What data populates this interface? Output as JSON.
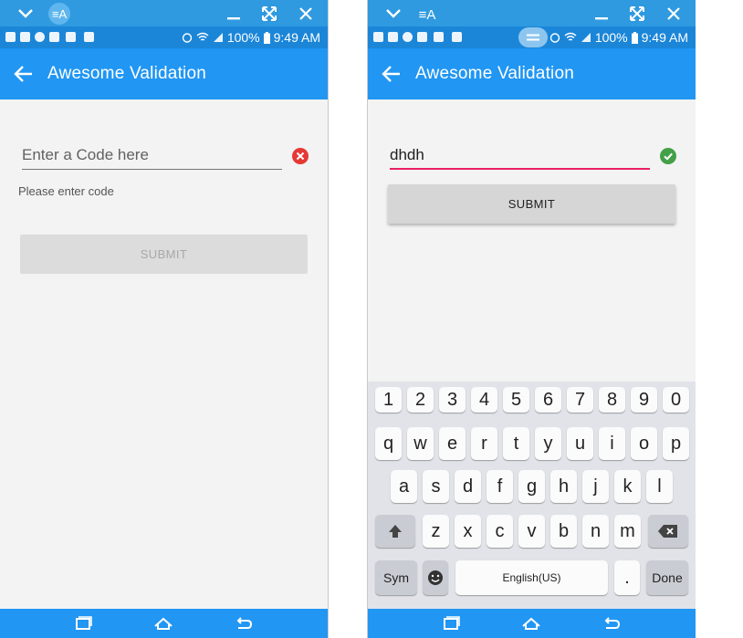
{
  "mirror_bar": {
    "icons": [
      "chevron-down-icon",
      "screen-mirror-app-icon",
      "minimize-icon",
      "fullscreen-icon",
      "close-icon"
    ]
  },
  "status_bar": {
    "battery": "100%",
    "time": "9:49 AM"
  },
  "app": {
    "title": "Awesome Validation"
  },
  "left_screen": {
    "code_input": {
      "value": "",
      "placeholder": "Enter a Code here"
    },
    "error_message": "Please enter code",
    "submit_label": "SUBMIT",
    "validation_icon": "error-icon",
    "colors": {
      "error": "#e53935"
    }
  },
  "right_screen": {
    "code_input": {
      "value": "dhdh",
      "placeholder": "Enter a Code here"
    },
    "submit_label": "SUBMIT",
    "validation_icon": "check-icon",
    "colors": {
      "success": "#43a047",
      "focus_line": "#e91e63"
    }
  },
  "keyboard": {
    "rows": [
      [
        "1",
        "2",
        "3",
        "4",
        "5",
        "6",
        "7",
        "8",
        "9",
        "0"
      ],
      [
        "q",
        "w",
        "e",
        "r",
        "t",
        "y",
        "u",
        "i",
        "o",
        "p"
      ],
      [
        "a",
        "s",
        "d",
        "f",
        "g",
        "h",
        "j",
        "k",
        "l"
      ],
      [
        "z",
        "x",
        "c",
        "v",
        "b",
        "n",
        "m"
      ]
    ],
    "sym_label": "Sym",
    "space_label": "English(US)",
    "period_label": ".",
    "done_label": "Done"
  },
  "colors": {
    "app_bar": "#2196f3",
    "status_bar": "#1b86d8",
    "mirror_bar": "#2f9ae0"
  }
}
